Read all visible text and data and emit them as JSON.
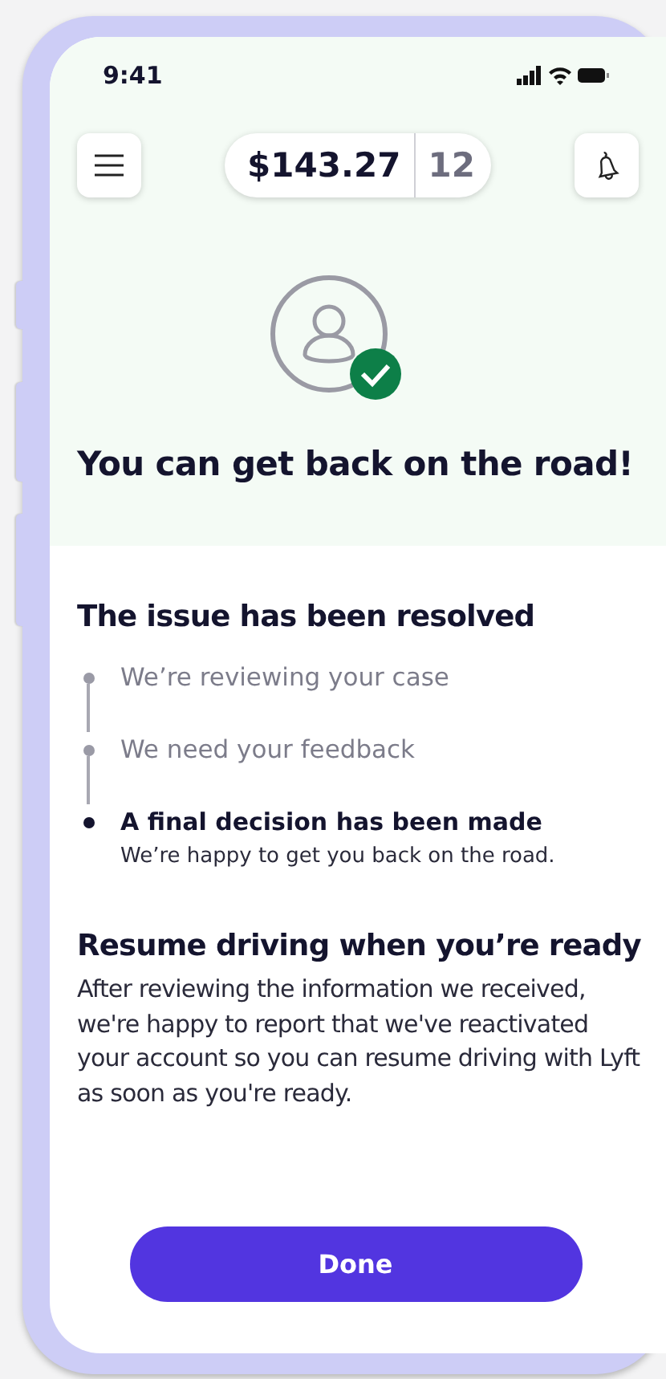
{
  "status_bar": {
    "time": "9:41"
  },
  "header": {
    "earnings": "$143.27",
    "count": "12"
  },
  "hero": {
    "title": "You can get back on the road!"
  },
  "progress": {
    "title": "The issue has been resolved",
    "steps": [
      {
        "label": "We’re reviewing your case",
        "current": false
      },
      {
        "label": "We need your feedback",
        "current": false
      },
      {
        "label": "A final decision has been made",
        "current": true,
        "detail": "We’re happy to get you back on the road."
      }
    ]
  },
  "resume": {
    "title": "Resume driving when you’re ready",
    "body": "After reviewing the information we received, we're happy to report that we've reactivated your account so you can resume driving with Lyft as soon as you're ready."
  },
  "buttons": [
    "Done"
  ]
}
